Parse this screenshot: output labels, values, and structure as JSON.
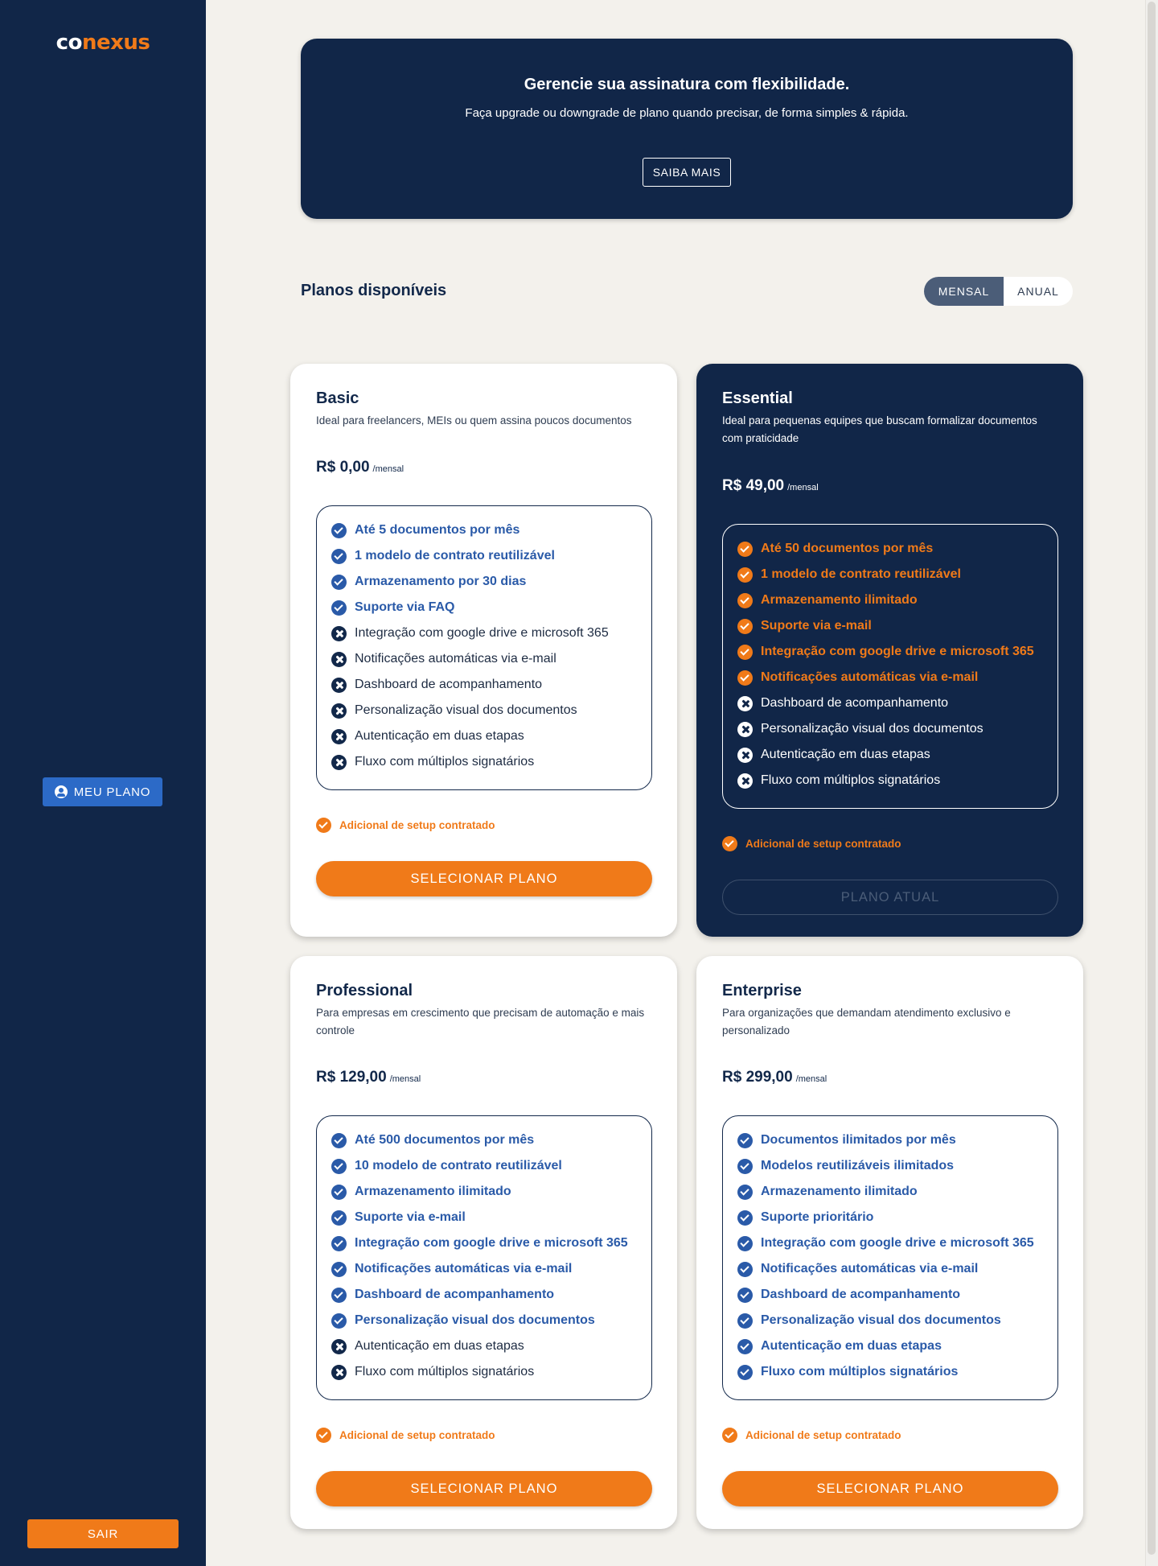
{
  "sidebar": {
    "logo_part1": "co",
    "logo_part2": "nexus",
    "my_plan_label": "MEU PLANO",
    "logout_label": "SAIR"
  },
  "hero": {
    "title": "Gerencie sua assinatura com flexibilidade.",
    "subtitle": "Faça upgrade ou downgrade de plano quando precisar, de forma simples & rápida.",
    "button_label": "SAIBA MAIS"
  },
  "plans_section": {
    "title": "Planos disponíveis",
    "toggle": {
      "monthly": "MENSAL",
      "annual": "ANUAL",
      "selected": "MENSAL"
    }
  },
  "colors": {
    "navy": "#112648",
    "orange": "#f07a19",
    "blue": "#2a5aa8",
    "background": "#f3f1ec"
  },
  "plans": [
    {
      "name": "Basic",
      "description": "Ideal para freelancers, MEIs ou quem assina poucos documentos",
      "price": "R$ 0,00",
      "period": "/mensal",
      "features": [
        {
          "text": "Até 5 documentos por mês",
          "included": true
        },
        {
          "text": "1 modelo de contrato reutilizável",
          "included": true
        },
        {
          "text": "Armazenamento por 30 dias",
          "included": true
        },
        {
          "text": "Suporte via FAQ",
          "included": true
        },
        {
          "text": "Integração com google drive e microsoft 365",
          "included": false
        },
        {
          "text": "Notificações automáticas via e-mail",
          "included": false
        },
        {
          "text": "Dashboard de acompanhamento",
          "included": false
        },
        {
          "text": "Personalização visual dos documentos",
          "included": false
        },
        {
          "text": "Autenticação em duas etapas",
          "included": false
        },
        {
          "text": "Fluxo com múltiplos signatários",
          "included": false
        }
      ],
      "setup_note": "Adicional de setup contratado",
      "action_label": "SELECIONAR PLANO"
    },
    {
      "name": "Essential",
      "description": "Ideal para pequenas equipes que buscam formalizar documentos com praticidade",
      "price": "R$ 49,00",
      "period": "/mensal",
      "features": [
        {
          "text": "Até 50 documentos por mês",
          "included": true
        },
        {
          "text": "1 modelo de contrato reutilizável",
          "included": true
        },
        {
          "text": "Armazenamento ilimitado",
          "included": true
        },
        {
          "text": "Suporte via e-mail",
          "included": true
        },
        {
          "text": "Integração com google drive e microsoft 365",
          "included": true
        },
        {
          "text": "Notificações automáticas via e-mail",
          "included": true
        },
        {
          "text": "Dashboard de acompanhamento",
          "included": false
        },
        {
          "text": "Personalização visual dos documentos",
          "included": false
        },
        {
          "text": "Autenticação em duas etapas",
          "included": false
        },
        {
          "text": "Fluxo com múltiplos signatários",
          "included": false
        }
      ],
      "setup_note": "Adicional de setup contratado",
      "action_label": "PLANO ATUAL",
      "current": true
    },
    {
      "name": "Professional",
      "description": "Para empresas em crescimento que precisam de automação e mais controle",
      "price": "R$ 129,00",
      "period": "/mensal",
      "features": [
        {
          "text": "Até 500 documentos por mês",
          "included": true
        },
        {
          "text": "10 modelo de contrato reutilizável",
          "included": true
        },
        {
          "text": "Armazenamento ilimitado",
          "included": true
        },
        {
          "text": "Suporte via e-mail",
          "included": true
        },
        {
          "text": "Integração com google drive e microsoft 365",
          "included": true
        },
        {
          "text": "Notificações automáticas via e-mail",
          "included": true
        },
        {
          "text": "Dashboard de acompanhamento",
          "included": true
        },
        {
          "text": "Personalização visual dos documentos",
          "included": true
        },
        {
          "text": "Autenticação em duas etapas",
          "included": false
        },
        {
          "text": "Fluxo com múltiplos signatários",
          "included": false
        }
      ],
      "setup_note": "Adicional de setup contratado",
      "action_label": "SELECIONAR PLANO"
    },
    {
      "name": "Enterprise",
      "description": "Para organizações que demandam atendimento exclusivo e personalizado",
      "price": "R$ 299,00",
      "period": "/mensal",
      "features": [
        {
          "text": "Documentos ilimitados por mês",
          "included": true
        },
        {
          "text": "Modelos reutilizáveis ilimitados",
          "included": true
        },
        {
          "text": "Armazenamento ilimitado",
          "included": true
        },
        {
          "text": "Suporte prioritário",
          "included": true
        },
        {
          "text": "Integração com google drive e microsoft 365",
          "included": true
        },
        {
          "text": "Notificações automáticas via e-mail",
          "included": true
        },
        {
          "text": "Dashboard de acompanhamento",
          "included": true
        },
        {
          "text": "Personalização visual dos documentos",
          "included": true
        },
        {
          "text": "Autenticação em duas etapas",
          "included": true
        },
        {
          "text": "Fluxo com múltiplos signatários",
          "included": true
        }
      ],
      "setup_note": "Adicional de setup contratado",
      "action_label": "SELECIONAR PLANO"
    }
  ]
}
